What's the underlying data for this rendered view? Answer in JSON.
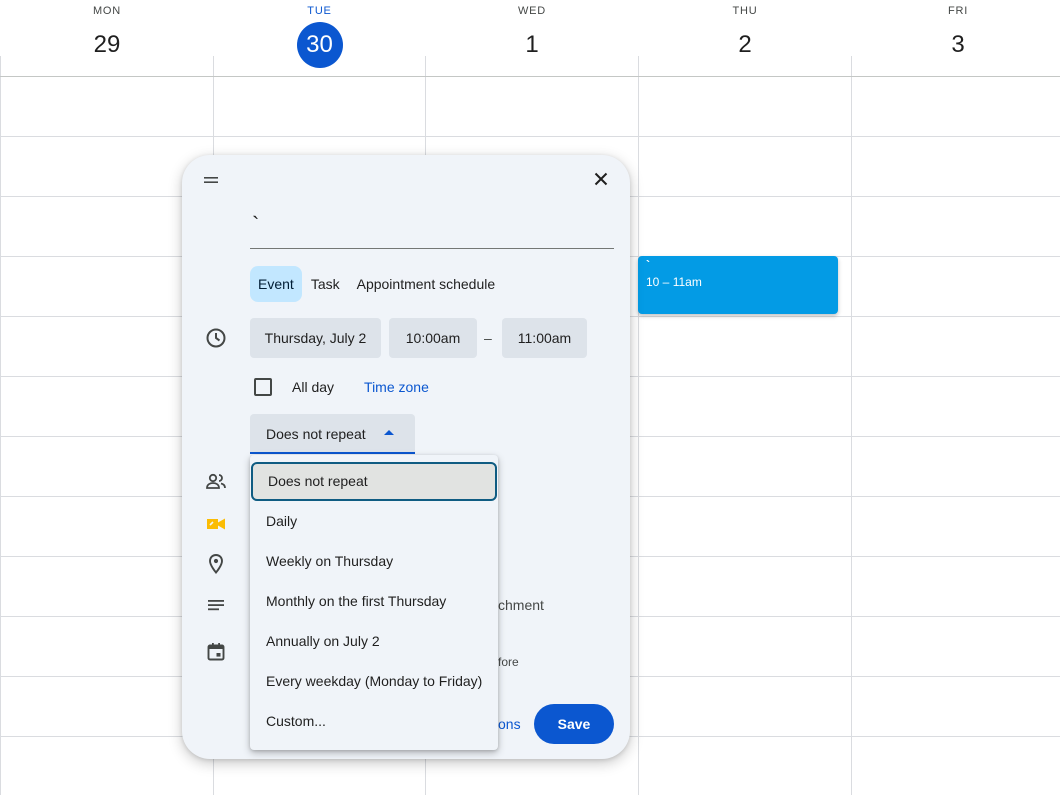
{
  "calendar": {
    "days": [
      {
        "name": "MON",
        "number": "29"
      },
      {
        "name": "TUE",
        "number": "30",
        "today": true
      },
      {
        "name": "WED",
        "number": "1"
      },
      {
        "name": "THU",
        "number": "2"
      },
      {
        "name": "FRI",
        "number": "3"
      }
    ],
    "event_chip": {
      "title": "`",
      "time": "10 – 11am"
    }
  },
  "dialog": {
    "title_value": "`",
    "tabs": [
      {
        "label": "Event",
        "active": true
      },
      {
        "label": "Task"
      },
      {
        "label": "Appointment schedule"
      }
    ],
    "date_label": "Thursday, July 2",
    "start_time": "10:00am",
    "time_separator": "–",
    "end_time": "11:00am",
    "all_day_label": "All day",
    "all_day_checked": false,
    "time_zone_link": "Time zone",
    "repeat_value": "Does not repeat",
    "partial_texts": {
      "attachment": "chment",
      "before": "fore",
      "options_link": "ons"
    },
    "save_label": "Save"
  },
  "repeat_dropdown": {
    "options": [
      {
        "label": "Does not repeat",
        "selected": true
      },
      {
        "label": "Daily"
      },
      {
        "label": "Weekly on Thursday"
      },
      {
        "label": "Monthly on the first Thursday"
      },
      {
        "label": "Annually on July 2"
      },
      {
        "label": "Every weekday (Monday to Friday)"
      },
      {
        "label": "Custom..."
      }
    ]
  },
  "colors": {
    "accent": "#0b57d0",
    "event": "#039be5",
    "tab_active": "#c2e7ff",
    "meet_icon": "#fbbc04"
  },
  "icons": [
    "drag-handle-icon",
    "close-icon",
    "clock-icon",
    "people-icon",
    "video-call-icon",
    "location-icon",
    "description-icon",
    "calendar-icon",
    "caret-up-icon"
  ]
}
